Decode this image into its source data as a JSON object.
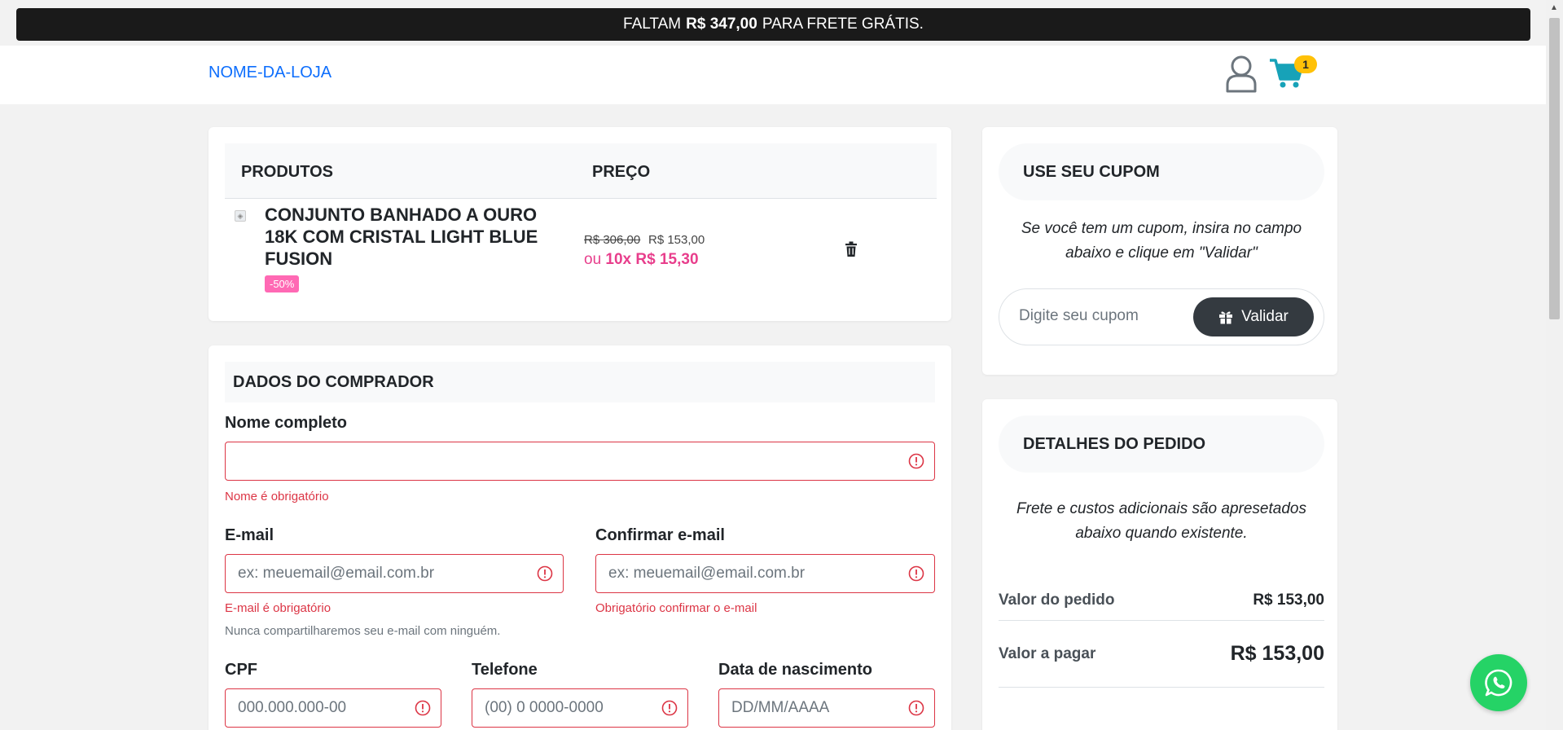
{
  "topbar": {
    "prefix": "FALTAM",
    "amount": "R$ 347,00",
    "suffix": "PARA FRETE GRÁTIS."
  },
  "header": {
    "brand": "NOME-DA-LOJA",
    "cart_count": "1",
    "colors": {
      "brand": "#0d6efd",
      "cart": "#17a2b8",
      "badge": "#ffc107"
    }
  },
  "products": {
    "col_products": "PRODUTOS",
    "col_price": "PREÇO",
    "items": [
      {
        "name": "CONJUNTO BANHADO A OURO 18K COM CRISTAL LIGHT BLUE FUSION",
        "discount": "-50%",
        "old_price": "R$ 306,00",
        "price": "R$ 153,00",
        "installment_prefix": "ou",
        "installment": "10x R$ 15,30"
      }
    ]
  },
  "buyer": {
    "title": "DADOS DO COMPRADOR",
    "name_label": "Nome completo",
    "name_value": "",
    "name_error": "Nome é obrigatório",
    "email_label": "E-mail",
    "email_placeholder": "ex: meuemail@email.com.br",
    "email_error": "E-mail é obrigatório",
    "email_help": "Nunca compartilharemos seu e-mail com ninguém.",
    "confirm_label": "Confirmar e-mail",
    "confirm_placeholder": "ex: meuemail@email.com.br",
    "confirm_error": "Obrigatório confirmar o e-mail",
    "cpf_label": "CPF",
    "cpf_placeholder": "000.000.000-00",
    "phone_label": "Telefone",
    "phone_placeholder": "(00) 0 0000-0000",
    "birth_label": "Data de nascimento",
    "birth_placeholder": "DD/MM/AAAA"
  },
  "coupon": {
    "title": "USE SEU CUPOM",
    "description": "Se você tem um cupom, insira no campo abaixo e clique em \"Validar\"",
    "placeholder": "Digite seu cupom",
    "button": "Validar"
  },
  "order": {
    "title": "DETALHES DO PEDIDO",
    "description": "Frete e custos adicionais são apresetados abaixo quando existente.",
    "order_value_label": "Valor do pedido",
    "order_value": "R$ 153,00",
    "pay_label": "Valor a pagar",
    "pay_value": "R$ 153,00"
  }
}
